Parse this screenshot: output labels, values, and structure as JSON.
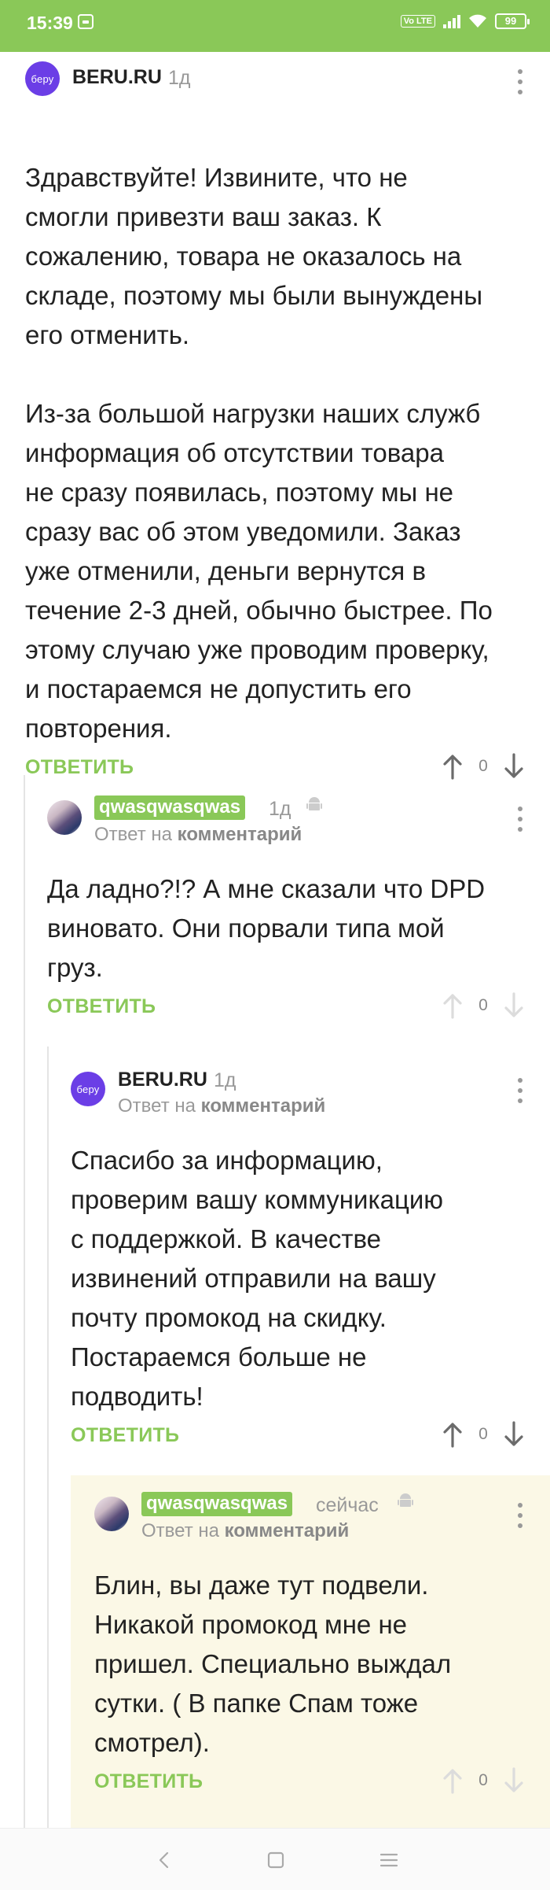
{
  "status_bar": {
    "time": "15:39",
    "network": "Vo LTE",
    "battery": "99"
  },
  "colors": {
    "accent": "#8ac858",
    "brand_avatar": "#6b3ee6",
    "highlight_bg": "#fbf8e6"
  },
  "comments": [
    {
      "author": "BERU.RU",
      "avatar_text": "беру",
      "time": "1д",
      "reply_prefix": "",
      "reply_link": "",
      "body": "Здравствуйте! Извините, что не\nсмогли привезти ваш заказ. К\nсожалению, товара не оказалось на\nскладе, поэтому мы были вынуждены\nего отменить.\n\nИз-за большой нагрузки наших служб\nинформация об отсутствии товара\nне сразу появилась, поэтому мы не\nсразу вас об этом уведомили. Заказ\nуже отменили, деньги вернутся в\nтечение 2-3 дней, обычно быстрее. По\nэтому случаю уже проводим проверку,\nи постараемся не допустить его\nповторения.",
      "reply_label": "ОТВЕТИТЬ",
      "score": "0"
    },
    {
      "author": "qwasqwasqwas",
      "time": "1д",
      "reply_prefix": "Ответ на",
      "reply_link": "комментарий",
      "body": "Да ладно?!? А мне сказали что DPD\nвиновато. Они порвали типа мой\nгруз.",
      "reply_label": "ОТВЕТИТЬ",
      "score": "0"
    },
    {
      "author": "BERU.RU",
      "avatar_text": "беру",
      "time": "1д",
      "reply_prefix": "Ответ на",
      "reply_link": "комментарий",
      "body": "Спасибо за информацию,\nпроверим вашу коммуникацию\nс поддержкой. В качестве\nизвинений отправили на вашу\nпочту промокод на скидку.\nПостараемся больше не\nподводить!",
      "reply_label": "ОТВЕТИТЬ",
      "score": "0"
    },
    {
      "author": "qwasqwasqwas",
      "time": "сейчас",
      "reply_prefix": "Ответ на",
      "reply_link": "комментарий",
      "body": "Блин, вы даже тут подвели.\nНикакой промокод мне не\nпришел. Специально выждал\nсутки. ( В папке Спам тоже\nсмотрел).",
      "reply_label": "ОТВЕТИТЬ",
      "score": "0"
    }
  ],
  "icons": {
    "upvote": "arrow-up-icon",
    "downvote": "arrow-down-icon",
    "more": "more-vertical-icon",
    "device": "android-icon",
    "nav_back": "back-icon",
    "nav_home": "home-icon",
    "nav_menu": "menu-icon"
  }
}
